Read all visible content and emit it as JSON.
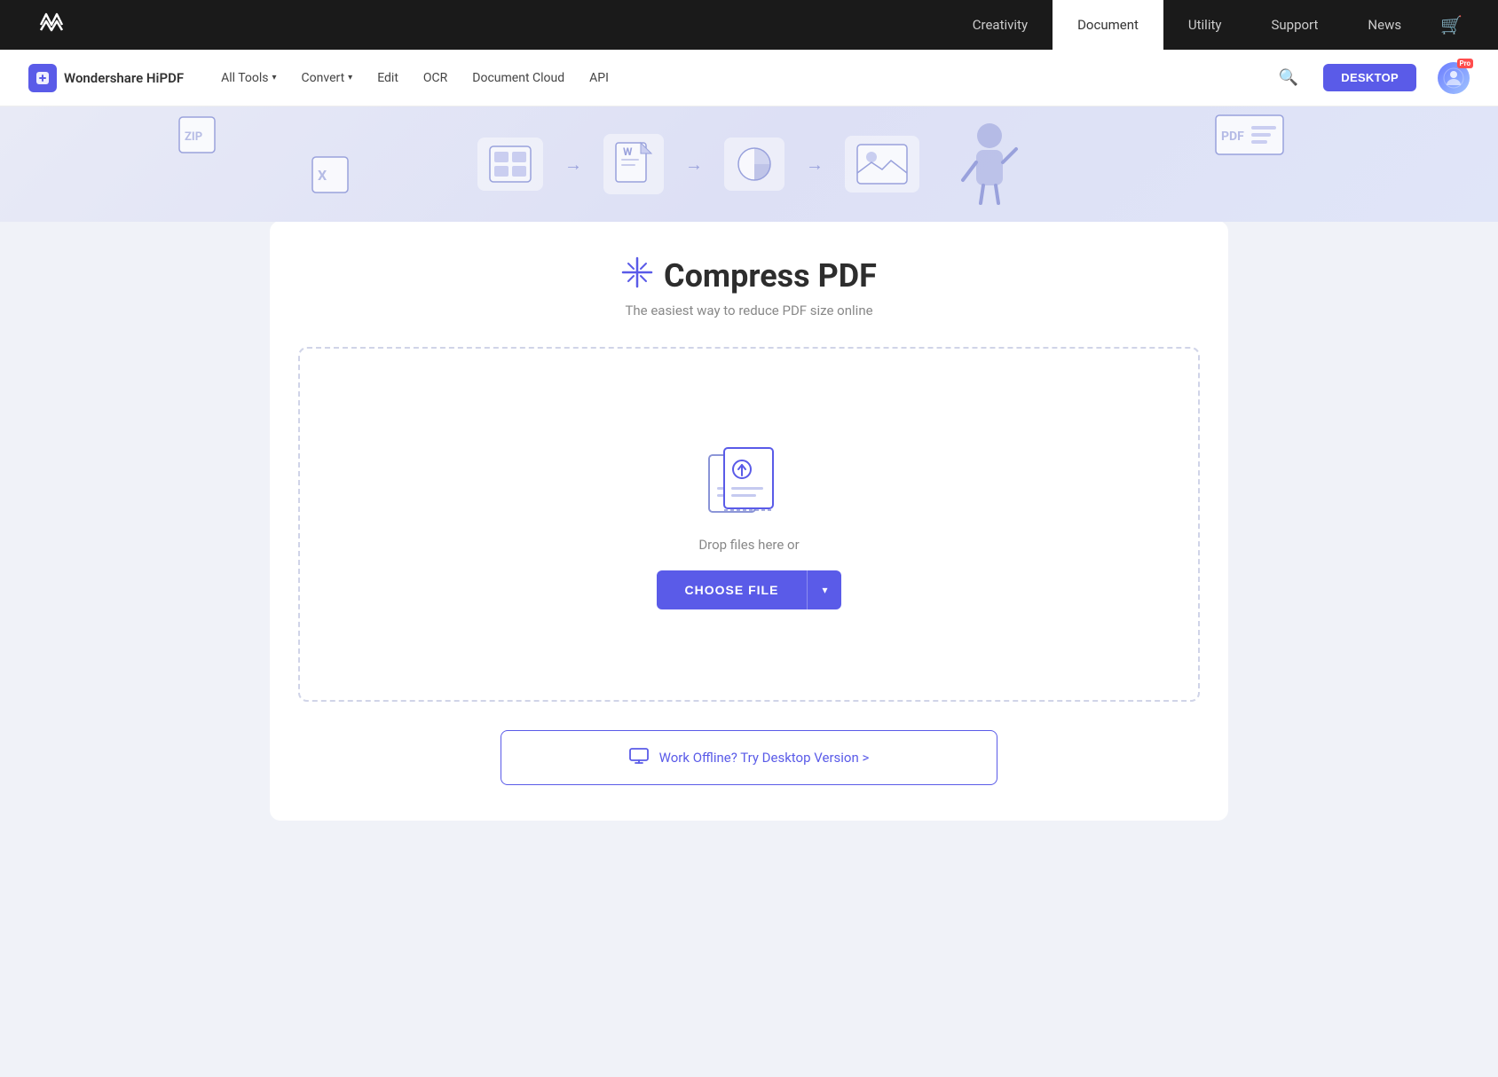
{
  "top_nav": {
    "logo_alt": "Wondershare",
    "links": [
      {
        "id": "creativity",
        "label": "Creativity",
        "active": false
      },
      {
        "id": "document",
        "label": "Document",
        "active": true
      },
      {
        "id": "utility",
        "label": "Utility",
        "active": false
      },
      {
        "id": "support",
        "label": "Support",
        "active": false
      },
      {
        "id": "news",
        "label": "News",
        "active": false
      }
    ]
  },
  "secondary_nav": {
    "brand": "Wondershare HiPDF",
    "items": [
      {
        "id": "all-tools",
        "label": "All Tools",
        "has_dropdown": true
      },
      {
        "id": "convert",
        "label": "Convert",
        "has_dropdown": true
      },
      {
        "id": "edit",
        "label": "Edit",
        "has_dropdown": false
      },
      {
        "id": "ocr",
        "label": "OCR",
        "has_dropdown": false
      },
      {
        "id": "document-cloud",
        "label": "Document Cloud",
        "has_dropdown": false
      },
      {
        "id": "api",
        "label": "API",
        "has_dropdown": false
      }
    ],
    "desktop_btn": "DESKTOP",
    "pro_badge": "Pro"
  },
  "tool": {
    "title": "Compress PDF",
    "subtitle": "The easiest way to reduce PDF size online",
    "drop_text": "Drop files here or",
    "choose_file_btn": "CHOOSE FILE"
  },
  "offline_banner": {
    "text": "Work Offline? Try Desktop Version >"
  },
  "colors": {
    "brand": "#5a5be8",
    "pro_badge": "#ff4d4d"
  }
}
